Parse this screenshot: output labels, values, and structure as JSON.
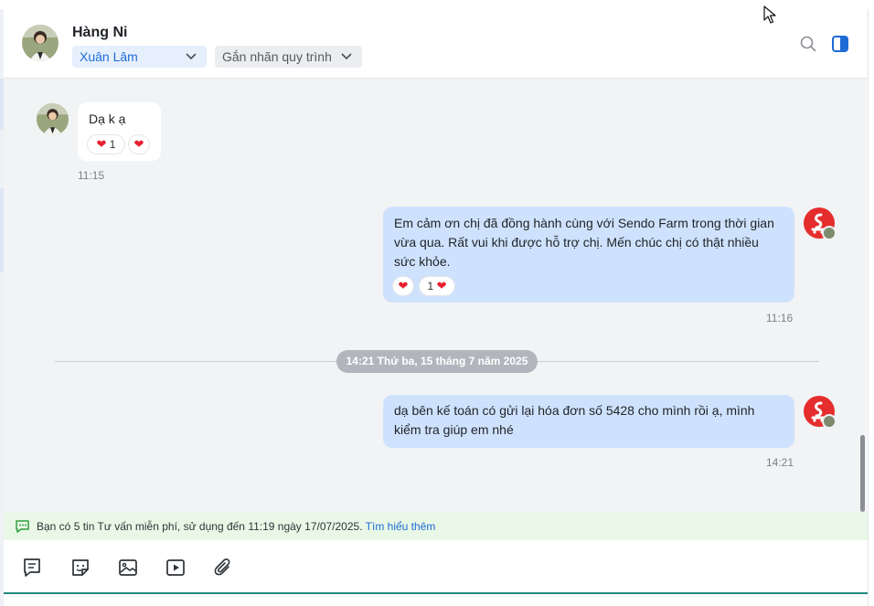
{
  "contact": {
    "name": "Hàng Ni",
    "assignee": "Xuân Lâm",
    "tag_placeholder": "Gắn nhãn quy trình"
  },
  "header_icons": [
    "search-icon",
    "panel-toggle-icon"
  ],
  "messages": [
    {
      "side": "in",
      "text": "Dạ k ạ",
      "time": "11:15",
      "reactions": [
        {
          "emoji": "heart",
          "count": "1"
        },
        {
          "emoji": "heart",
          "count": ""
        }
      ]
    },
    {
      "side": "out",
      "text": "Em cảm ơn chị đã đồng hành cùng với Sendo Farm trong thời gian vừa qua. Rất vui khi được hỗ trợ chị. Mến chúc chị có thật nhiều sức khỏe.",
      "time": "11:16",
      "reactions": [
        {
          "emoji": "heart",
          "count": ""
        },
        {
          "emoji": "heart",
          "count": "1"
        }
      ]
    },
    {
      "side": "out",
      "text": "dạ bên kế toán có gửi lại hóa đơn số 5428 cho mình rồi ạ, mình kiểm tra giúp em nhé",
      "time": "14:21",
      "reactions": []
    }
  ],
  "date_divider": "14:21 Thứ ba, 15 tháng 7 năm 2025",
  "notice": {
    "text": "Bạn có 5 tin Tư vấn miễn phí, sử dụng đến 11:19 ngày 17/07/2025.",
    "link": "Tìm hiểu thêm"
  },
  "toolbar_icons": [
    "quick-reply-icon",
    "sticker-icon",
    "image-icon",
    "video-icon",
    "attachment-icon"
  ],
  "colors": {
    "accent": "#1e6bd6",
    "outgoing_bubble": "#cfe2fd",
    "chat_bg": "#f2f3f5",
    "sendo_red": "#e52d2d",
    "notice_bg": "#e9f8e6"
  }
}
